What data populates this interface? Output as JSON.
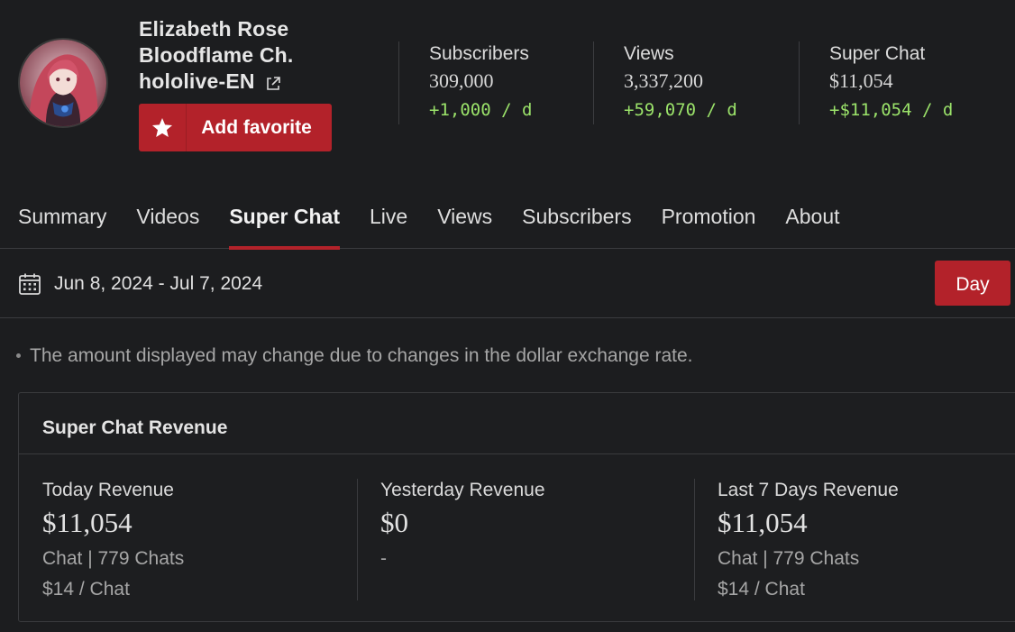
{
  "channel": {
    "name_line1": "Elizabeth Rose",
    "name_line2": "Bloodflame Ch.",
    "handle": "hololive-EN",
    "favorite_label": "Add favorite"
  },
  "stats": [
    {
      "label": "Subscribers",
      "value": "309,000",
      "delta": "+1,000 / d"
    },
    {
      "label": "Views",
      "value": "3,337,200",
      "delta": "+59,070 / d"
    },
    {
      "label": "Super Chat",
      "value": "$11,054",
      "delta": "+$11,054 / d"
    }
  ],
  "tabs": [
    "Summary",
    "Videos",
    "Super Chat",
    "Live",
    "Views",
    "Subscribers",
    "Promotion",
    "About"
  ],
  "active_tab": "Super Chat",
  "date_bar": {
    "range": "Jun 8, 2024 - Jul 7, 2024",
    "period_button": "Day"
  },
  "note": "The amount displayed may change due to changes in the dollar exchange rate.",
  "revenue_card": {
    "title": "Super Chat Revenue",
    "columns": [
      {
        "label": "Today Revenue",
        "amount": "$11,054",
        "line1": "Chat | 779 Chats",
        "line2": "$14 / Chat"
      },
      {
        "label": "Yesterday Revenue",
        "amount": "$0",
        "line1": "-",
        "line2": ""
      },
      {
        "label": "Last 7 Days Revenue",
        "amount": "$11,054",
        "line1": "Chat | 779 Chats",
        "line2": "$14 / Chat"
      }
    ]
  },
  "colors": {
    "accent": "#b3222a",
    "delta_green": "#9be36a",
    "background": "#1c1d1f"
  },
  "icons": {
    "favorite": "star-icon",
    "external": "external-link-icon",
    "calendar": "calendar-icon"
  }
}
